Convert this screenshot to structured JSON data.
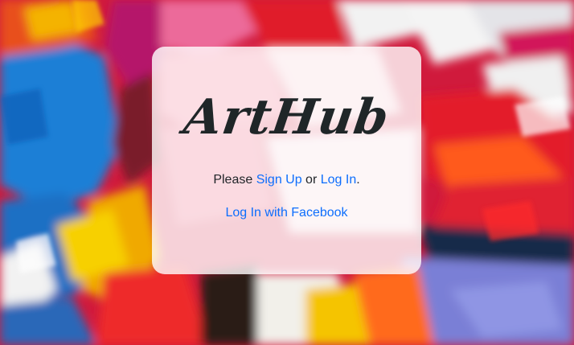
{
  "app": {
    "logo_text": "ArtHub"
  },
  "auth": {
    "prefix": "Please ",
    "sign_up_label": "Sign Up",
    "or_text": " or ",
    "log_in_label": "Log In",
    "suffix": ".",
    "facebook_label": "Log In with Facebook"
  },
  "colors": {
    "link": "#0d6efd",
    "logo": "#1f2628",
    "text": "#212529",
    "card_overlay": "rgba(255,255,255,0.80)"
  },
  "icons": {
    "background": "abstract-paint-background"
  }
}
